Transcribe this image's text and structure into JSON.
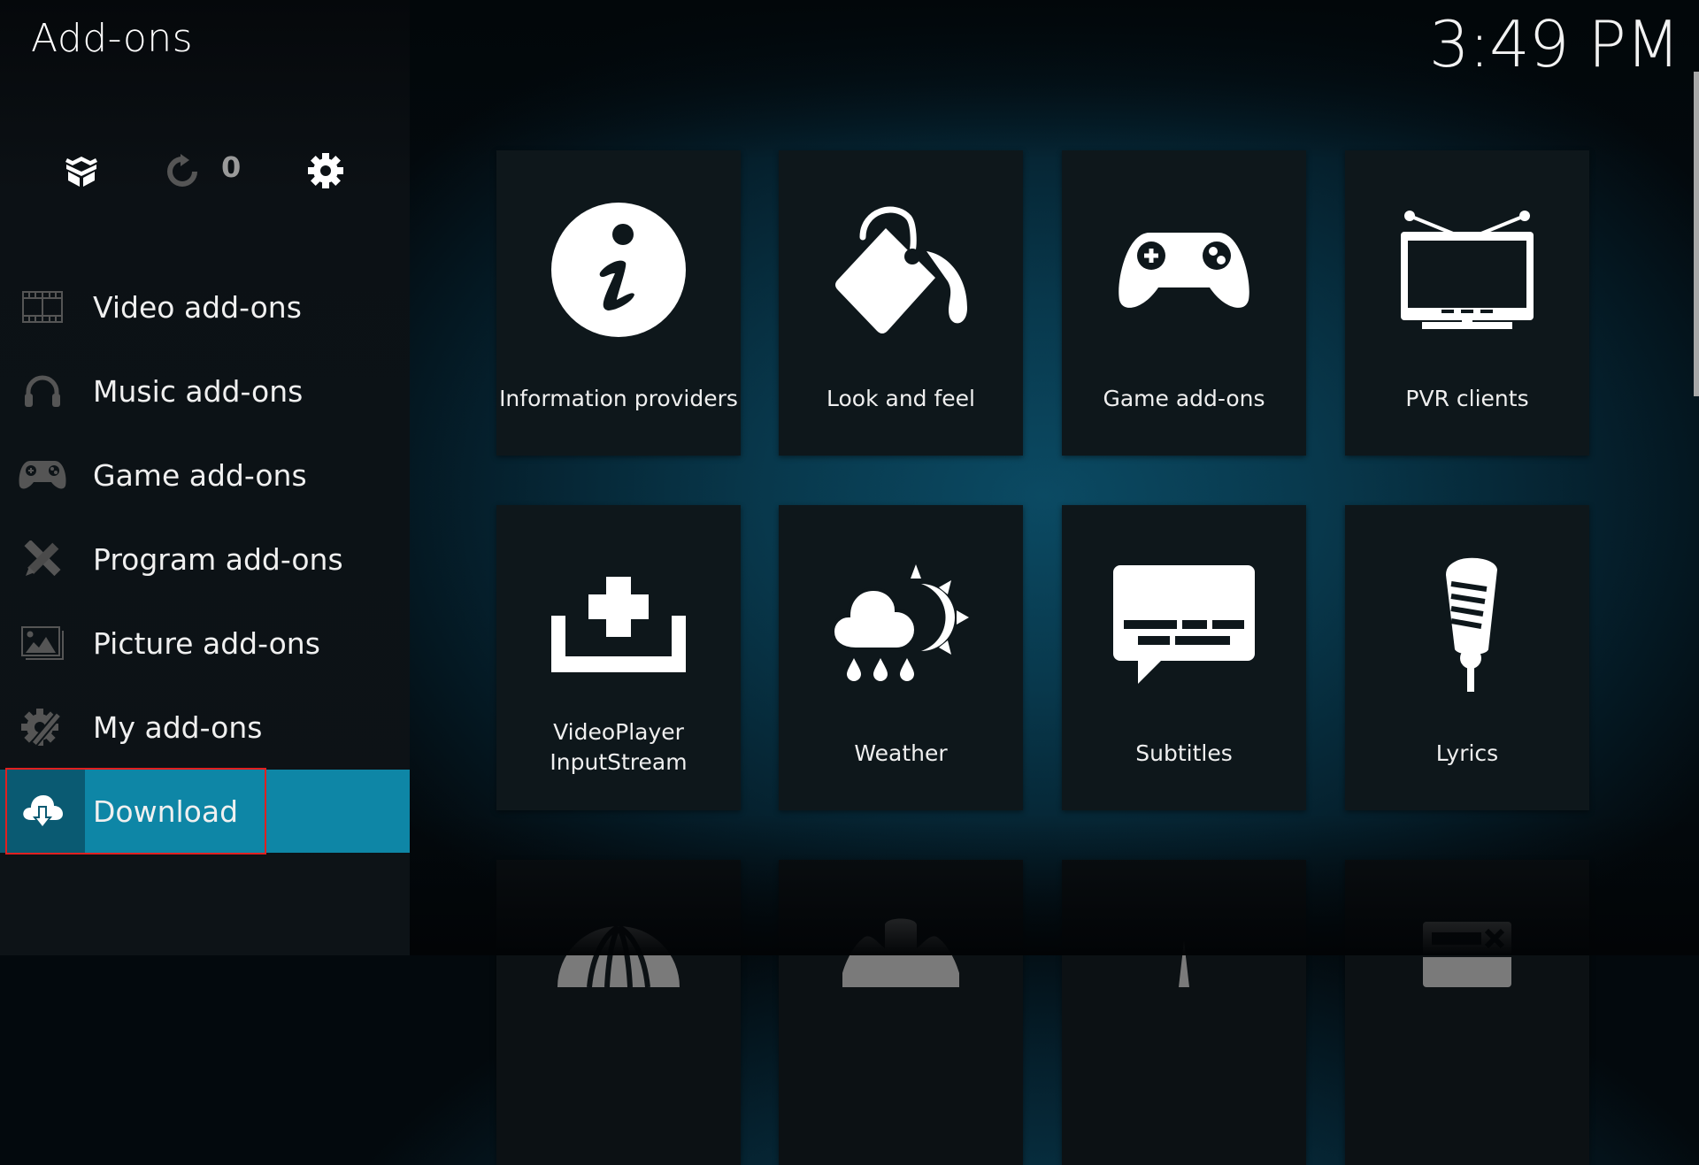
{
  "header": {
    "title": "Add-ons",
    "clock": "3:49 PM"
  },
  "toolbar": {
    "install_from_zip_icon": "open-box-icon",
    "update_icon": "refresh-icon",
    "update_count": "0",
    "settings_icon": "gear-icon"
  },
  "sidebar": {
    "items": [
      {
        "label": "Video add-ons",
        "icon": "film-strip-icon",
        "active": false
      },
      {
        "label": "Music add-ons",
        "icon": "headphones-icon",
        "active": false
      },
      {
        "label": "Game add-ons",
        "icon": "gamepad-icon",
        "active": false
      },
      {
        "label": "Program add-ons",
        "icon": "pencil-ruler-icon",
        "active": false
      },
      {
        "label": "Picture add-ons",
        "icon": "picture-icon",
        "active": false
      },
      {
        "label": "My add-ons",
        "icon": "gear-wrench-icon",
        "active": false
      },
      {
        "label": "Download",
        "icon": "cloud-download-icon",
        "active": true
      }
    ]
  },
  "colors": {
    "accent": "#0e86a6",
    "accent_dark": "#0a5a72",
    "highlight_outline": "#e02020"
  },
  "grid": {
    "tiles": [
      {
        "label": "Information providers",
        "icon": "info-icon"
      },
      {
        "label": "Look and feel",
        "icon": "paint-bucket-icon"
      },
      {
        "label": "Game add-ons",
        "icon": "gamepad-icon"
      },
      {
        "label": "PVR clients",
        "icon": "tv-icon"
      },
      {
        "label": "VideoPlayer InputStream",
        "label_line1": "VideoPlayer",
        "label_line2": "InputStream",
        "icon": "install-tray-icon"
      },
      {
        "label": "Weather",
        "icon": "weather-icon"
      },
      {
        "label": "Subtitles",
        "icon": "subtitles-icon"
      },
      {
        "label": "Lyrics",
        "icon": "microphone-icon"
      },
      {
        "label": "",
        "icon": "globe-icon"
      },
      {
        "label": "",
        "icon": "puzzle-icon"
      },
      {
        "label": "",
        "icon": "waveform-icon"
      },
      {
        "label": "",
        "icon": "context-menu-icon"
      }
    ]
  }
}
